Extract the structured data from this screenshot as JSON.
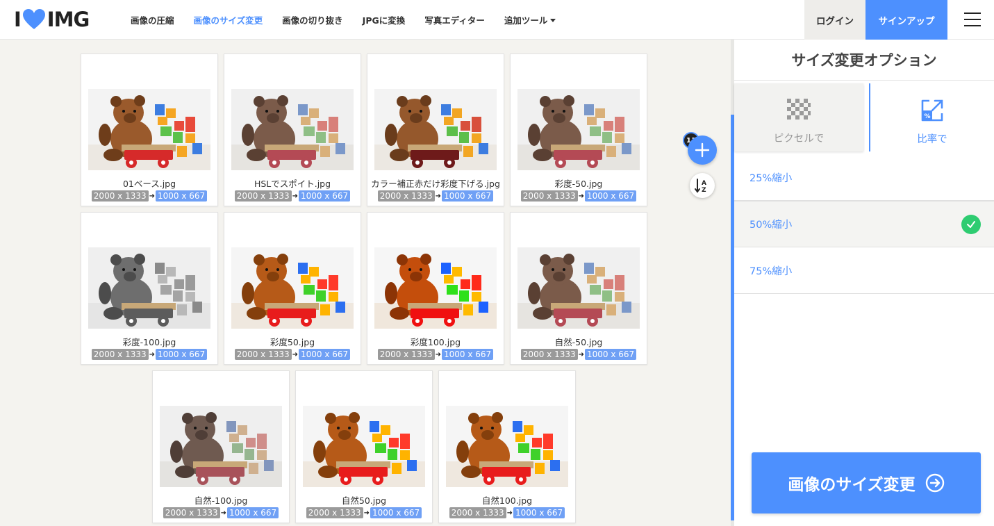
{
  "header": {
    "logo_left": "I",
    "logo_right": "IMG",
    "nav": [
      {
        "label": "画像の圧縮"
      },
      {
        "label": "画像のサイズ変更"
      },
      {
        "label": "画像の切り抜き"
      },
      {
        "label": "JPGに変換"
      },
      {
        "label": "写真エディター"
      },
      {
        "label": "追加ツール"
      }
    ],
    "login": "ログイン",
    "signup": "サインアップ"
  },
  "colors": {
    "accent": "#4d90fe",
    "check": "#2ecc71"
  },
  "files": [
    {
      "name": "01ベース.jpg",
      "old": "2000 x 1333",
      "new": "1000 x 667",
      "tone": "normal"
    },
    {
      "name": "HSLでスポイト.jpg",
      "old": "2000 x 1333",
      "new": "1000 x 667",
      "tone": "muted"
    },
    {
      "name": "カラー補正赤だけ彩度下げる.jpg",
      "old": "2000 x 1333",
      "new": "1000 x 667",
      "tone": "darkred"
    },
    {
      "name": "彩度-50.jpg",
      "old": "2000 x 1333",
      "new": "1000 x 667",
      "tone": "muted"
    },
    {
      "name": "彩度-100.jpg",
      "old": "2000 x 1333",
      "new": "1000 x 667",
      "tone": "gray"
    },
    {
      "name": "彩度50.jpg",
      "old": "2000 x 1333",
      "new": "1000 x 667",
      "tone": "vivid"
    },
    {
      "name": "彩度100.jpg",
      "old": "2000 x 1333",
      "new": "1000 x 667",
      "tone": "vivid2"
    },
    {
      "name": "自然-50.jpg",
      "old": "2000 x 1333",
      "new": "1000 x 667",
      "tone": "muted"
    },
    {
      "name": "自然-100.jpg",
      "old": "2000 x 1333",
      "new": "1000 x 667",
      "tone": "muted2"
    },
    {
      "name": "自然50.jpg",
      "old": "2000 x 1333",
      "new": "1000 x 667",
      "tone": "vivid"
    },
    {
      "name": "自然100.jpg",
      "old": "2000 x 1333",
      "new": "1000 x 667",
      "tone": "vivid"
    }
  ],
  "file_count": "11",
  "panel": {
    "title": "サイズ変更オプション",
    "mode_pixel": "ピクセルで",
    "mode_ratio": "比率で",
    "options": [
      {
        "label": "25%縮小",
        "selected": false
      },
      {
        "label": "50%縮小",
        "selected": true
      },
      {
        "label": "75%縮小",
        "selected": false
      }
    ],
    "resize_button": "画像のサイズ変更"
  }
}
